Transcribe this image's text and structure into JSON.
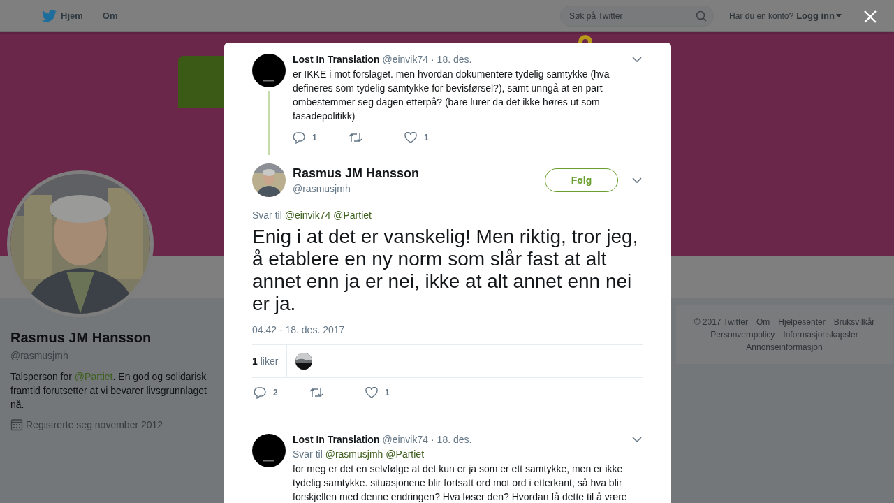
{
  "topbar": {
    "nav": [
      {
        "label": "Hjem",
        "kind": "home"
      },
      {
        "label": "Om",
        "kind": "plain"
      }
    ],
    "search": {
      "placeholder": "Søk på Twitter"
    },
    "account_prompt": "Har du en konto?",
    "login": "Logg inn"
  },
  "profile": {
    "name": "Rasmus JM Hansson",
    "handle": "@rasmusjmh",
    "bio": {
      "before": "Talsperson for ",
      "mention": "@Partiet",
      "after": ". En god og solidarisk framtid forutsetter at vi bevarer livsgrunnlaget nå."
    },
    "joined": "Registrerte seg november 2012"
  },
  "footer_links": [
    "© 2017 Twitter",
    "Om",
    "Hjelpesenter",
    "Bruksvilkår",
    "Personvernpolicy",
    "Informasjonskapsler",
    "Annonseinformasjon"
  ],
  "conversation": [
    {
      "kind": "reply",
      "name": "Lost In Translation",
      "handle": "@einvik74",
      "date": "· 18. des.",
      "thread_line": true,
      "text": "er IKKE i mot forslaget. men hvordan dokumentere tydelig samtykke (hva defineres som tydelig samtykke for bevisførsel?), samt unngå at en part ombestemmer seg dagen etterpå? (bare lurer da det ikke høres ut som fasadepolitikk)",
      "reply_count": "1",
      "like_count": "1"
    },
    {
      "kind": "focus",
      "name": "Rasmus JM Hansson",
      "handle": "@rasmusjmh",
      "follow": "Følg",
      "reply_label": "Svar til",
      "reply_to": [
        "@einvik74",
        "@Partiet"
      ],
      "text": "Enig i at det er vanskelig! Men riktig, tror jeg, å etablere en ny norm som slår fast at alt annet enn ja er nei, ikke at alt annet enn nei er ja.",
      "timestamp": "04.42 - 18. des. 2017",
      "likes_count": "1",
      "likes_label": "liker",
      "reply_count": "2",
      "like_count": "1"
    },
    {
      "kind": "reply",
      "name": "Lost In Translation",
      "handle": "@einvik74",
      "date": "· 18. des.",
      "thread_line": false,
      "reply_label": "Svar til",
      "reply_to": [
        "@rasmusjmh",
        "@Partiet"
      ],
      "text": "for meg er det en selvfølge at det kun er  ja som er ett samtykke, men er ikke tydelig samtykke. situasjonene blir fortsatt ord mot ord i etterkant, så hva blir forskjellen med denne endringen? Hva løser den? Hvordan få dette til å være"
    }
  ]
}
